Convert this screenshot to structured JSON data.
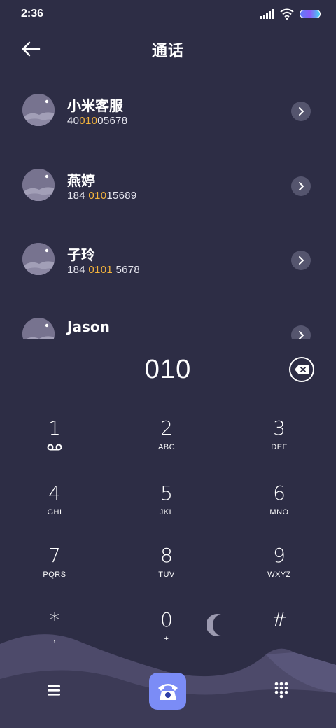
{
  "status_bar": {
    "time": "2:36"
  },
  "header": {
    "title": "通话"
  },
  "contacts": [
    {
      "name": "小米客服",
      "number_pre": "40",
      "number_match": "010",
      "number_post": "05678"
    },
    {
      "name": "燕婷",
      "number_pre": "184 ",
      "number_match": "010",
      "number_post": "15689"
    },
    {
      "name": "子玲",
      "number_pre": "184 ",
      "number_match": "0101",
      "number_post": " 5678"
    },
    {
      "name": "Jason",
      "number_pre": "",
      "number_match": "",
      "number_post": ""
    }
  ],
  "dialer": {
    "entered_number": "010"
  },
  "keypad": [
    {
      "digit": "1",
      "letters": "",
      "icon": "voicemail-icon"
    },
    {
      "digit": "2",
      "letters": "ABC"
    },
    {
      "digit": "3",
      "letters": "DEF"
    },
    {
      "digit": "4",
      "letters": "GHI"
    },
    {
      "digit": "5",
      "letters": "JKL"
    },
    {
      "digit": "6",
      "letters": "MNO"
    },
    {
      "digit": "7",
      "letters": "PQRS"
    },
    {
      "digit": "8",
      "letters": "TUV"
    },
    {
      "digit": "9",
      "letters": "WXYZ"
    },
    {
      "digit": "*",
      "letters": ","
    },
    {
      "digit": "0",
      "letters": "+"
    },
    {
      "digit": "#",
      "letters": ""
    }
  ],
  "colors": {
    "background": "#2d2d45",
    "highlight": "#f3b33c",
    "call_button": "#7b8cf6"
  }
}
